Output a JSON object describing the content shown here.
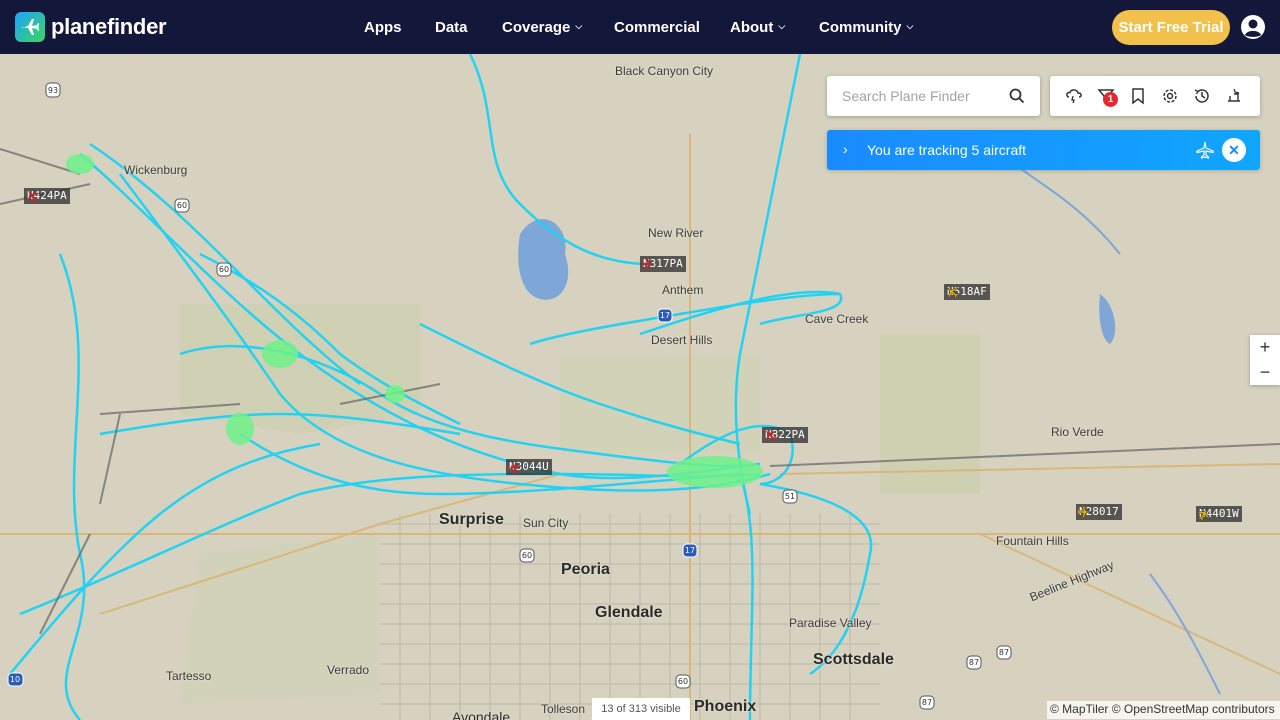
{
  "header": {
    "logo_text": "planefinder",
    "nav": [
      {
        "label": "Apps",
        "has_dropdown": false
      },
      {
        "label": "Data",
        "has_dropdown": false
      },
      {
        "label": "Coverage",
        "has_dropdown": true
      },
      {
        "label": "Commercial",
        "has_dropdown": false
      },
      {
        "label": "About",
        "has_dropdown": true
      },
      {
        "label": "Community",
        "has_dropdown": true
      }
    ],
    "cta_label": "Start Free Trial",
    "account_icon": "user-circle-icon"
  },
  "search": {
    "placeholder": "Search Plane Finder",
    "icon": "search-icon"
  },
  "toolbar": {
    "buttons": [
      "weather-icon",
      "filter-icon",
      "bookmark-icon",
      "settings-icon",
      "history-icon",
      "airport-icon"
    ],
    "filter_badge": "1"
  },
  "tracking": {
    "text": "You are tracking 5 aircraft",
    "icon": "plane-icon",
    "close_icon": "close-icon"
  },
  "zoom": {
    "in": "+",
    "out": "−"
  },
  "map": {
    "places": [
      {
        "name": "Black Canyon City",
        "size": "normal"
      },
      {
        "name": "Wickenburg",
        "size": "normal"
      },
      {
        "name": "New River",
        "size": "normal"
      },
      {
        "name": "Anthem",
        "size": "normal"
      },
      {
        "name": "Cave Creek",
        "size": "normal"
      },
      {
        "name": "Desert Hills",
        "size": "normal"
      },
      {
        "name": "Rio Verde",
        "size": "normal"
      },
      {
        "name": "Fountain Hills",
        "size": "normal"
      },
      {
        "name": "Surprise",
        "size": "big"
      },
      {
        "name": "Sun City",
        "size": "normal"
      },
      {
        "name": "Peoria",
        "size": "big"
      },
      {
        "name": "Glendale",
        "size": "big"
      },
      {
        "name": "Paradise Valley",
        "size": "normal"
      },
      {
        "name": "Scottsdale",
        "size": "big"
      },
      {
        "name": "Tartesso",
        "size": "normal"
      },
      {
        "name": "Verrado",
        "size": "normal"
      },
      {
        "name": "Avondale",
        "size": "mid"
      },
      {
        "name": "Tolleson",
        "size": "normal"
      },
      {
        "name": "Phoenix",
        "size": "big"
      },
      {
        "name": "Beeline Highway",
        "size": "normal"
      }
    ],
    "aircraft": [
      {
        "callsign": "N424PA",
        "color": "#c0282b"
      },
      {
        "callsign": "N317PA",
        "color": "#c0282b"
      },
      {
        "callsign": "N518AF",
        "color": "#e7b400"
      },
      {
        "callsign": "N822PA",
        "color": "#c0282b"
      },
      {
        "callsign": "N3044U",
        "color": "#c0282b"
      },
      {
        "callsign": "N28017",
        "color": "#e7b400"
      },
      {
        "callsign": "N4401W",
        "color": "#e7b400"
      }
    ],
    "track_color": "#1ad2f5",
    "route_shields": [
      "93",
      "60",
      "60",
      "17",
      "51",
      "60",
      "17",
      "60",
      "10",
      "87",
      "87",
      "87"
    ]
  },
  "status": {
    "visible_count": "13 of 313 visible",
    "attribution": "© MapTiler © OpenStreetMap contributors"
  },
  "colors": {
    "header_bg": "#13173a",
    "cta": "#f2c14b",
    "tracking_bar": "#1a8bff",
    "badge": "#e8272b"
  }
}
